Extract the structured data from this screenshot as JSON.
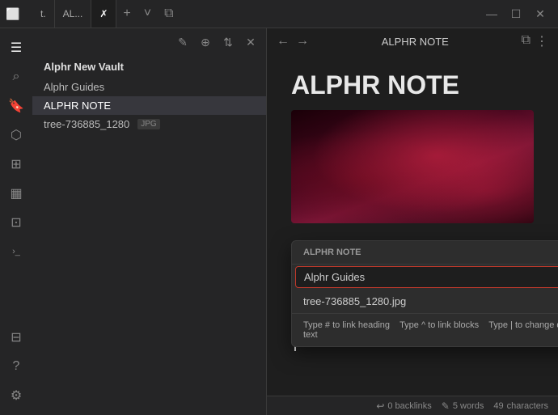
{
  "titlebar": {
    "tabs": [
      {
        "id": "t",
        "label": "t.",
        "active": false
      },
      {
        "id": "al",
        "label": "AL...",
        "active": false
      },
      {
        "id": "alphr",
        "label": "✗",
        "active": true,
        "icon": "✗"
      }
    ],
    "add_tab_label": "+",
    "chevron_label": "˅",
    "layout_icon": "⧉",
    "minimize_label": "—",
    "maximize_label": "☐",
    "close_label": "✕"
  },
  "sidebar_icons": {
    "icons": [
      {
        "name": "files-icon",
        "glyph": "☰"
      },
      {
        "name": "search-icon",
        "glyph": "⌕"
      },
      {
        "name": "bookmarks-icon",
        "glyph": "🔖"
      },
      {
        "name": "graph-icon",
        "glyph": "⬡"
      },
      {
        "name": "grid-icon",
        "glyph": "⊞"
      },
      {
        "name": "calendar-icon",
        "glyph": "▦"
      },
      {
        "name": "layers-icon",
        "glyph": "⊡"
      },
      {
        "name": "terminal-icon",
        "glyph": ">_"
      }
    ],
    "bottom_icons": [
      {
        "name": "template-icon",
        "glyph": "⊟"
      },
      {
        "name": "help-icon",
        "glyph": "?"
      },
      {
        "name": "settings-icon",
        "glyph": "⚙"
      }
    ]
  },
  "file_panel": {
    "toolbar_icons": [
      {
        "name": "new-file-icon",
        "glyph": "✎"
      },
      {
        "name": "new-folder-icon",
        "glyph": "⊕"
      },
      {
        "name": "sort-icon",
        "glyph": "⇅"
      },
      {
        "name": "close-panel-icon",
        "glyph": "✕"
      }
    ],
    "vault_name": "Alphr New Vault",
    "items": [
      {
        "label": "Alphr Guides",
        "active": false,
        "badge": null
      },
      {
        "label": "ALPHR NOTE",
        "active": true,
        "badge": null
      },
      {
        "label": "tree-736885_1280",
        "active": false,
        "badge": "JPG"
      }
    ]
  },
  "editor": {
    "title": "ALPHR NOTE",
    "nav_back": "←",
    "nav_forward": "→",
    "reader_icon": "⧉",
    "more_icon": "⋮",
    "note_title": "ALPHR NOTE",
    "cursor_visible": true
  },
  "autocomplete": {
    "header": "ALPHR NOTE",
    "items": [
      {
        "label": "Alphr Guides",
        "highlighted": true
      },
      {
        "label": "tree-736885_1280.jpg",
        "highlighted": false
      }
    ],
    "hint_parts": [
      {
        "text": "Type # to link heading",
        "separator": "  "
      },
      {
        "text": "Type ^ to link blocks",
        "separator": "  "
      },
      {
        "text": "Type | to change display text"
      }
    ]
  },
  "status_bar": {
    "backlinks_label": "0 backlinks",
    "backlinks_icon": "↩",
    "words_label": "5 words",
    "edit_icon": "✎",
    "chars_label": "49",
    "chars_suffix": "characters"
  }
}
